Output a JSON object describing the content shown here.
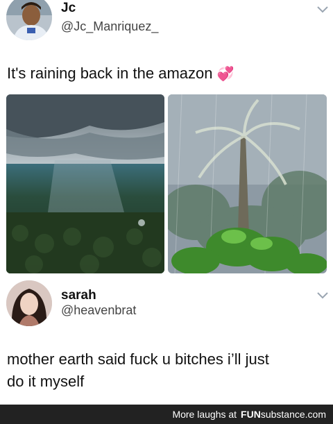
{
  "tweet1": {
    "name": "Jc",
    "handle": "@Jc_Manriquez_",
    "text": "It's raining back in the amazon",
    "emoji": "💞"
  },
  "tweet2": {
    "name": "sarah",
    "handle": "@heavenbrat",
    "text_line1": "mother earth said fuck u bitches i’ll just",
    "text_line2": "do it myself"
  },
  "footer": {
    "lead": "More laughs at",
    "brand_a": "FUN",
    "brand_b": "substance.com"
  },
  "icons": {
    "menu": "chevron-down-icon"
  }
}
